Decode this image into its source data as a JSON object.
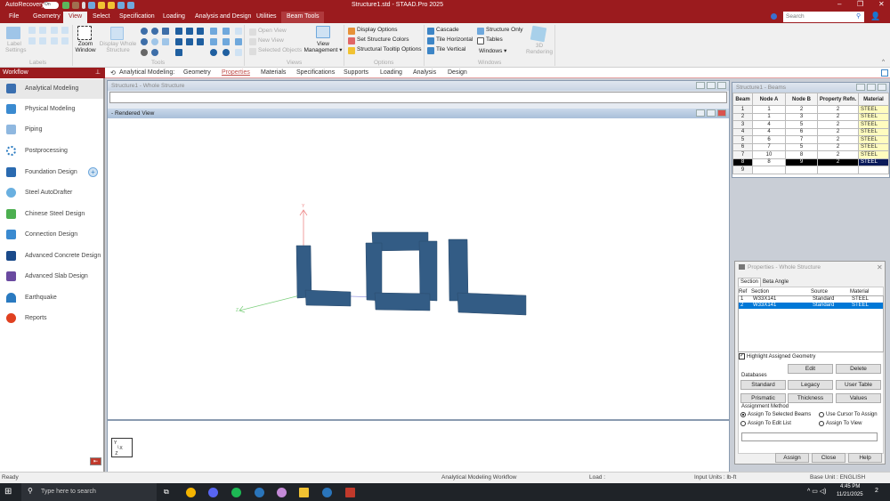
{
  "titlebar": {
    "autorecovery": "AutoRecovery",
    "toggle": "On",
    "title": "Structure1.std - STAAD.Pro 2025",
    "search_placeholder": "Search"
  },
  "tabs": [
    "File",
    "Geometry",
    "View",
    "Select",
    "Specification",
    "Loading",
    "Analysis and Design",
    "Utilities",
    "Beam Tools"
  ],
  "active_tab": "View",
  "ribbon": {
    "labels_group": {
      "label_settings": "Label Settings",
      "caption": "Labels"
    },
    "tools_group": {
      "zoom_window": "Zoom Window",
      "display_whole": "Display Whole Structure",
      "caption": "Tools"
    },
    "views_group": {
      "open_view": "Open View",
      "new_view": "New View",
      "selected_objects": "Selected Objects",
      "view_management": "View Management ▾",
      "caption": "Views"
    },
    "options_group": {
      "display_options": "Display Options",
      "set_colors": "Set Structure Colors",
      "tooltip_options": "Structural Tooltip Options",
      "caption": "Options"
    },
    "windows_group": {
      "cascade": "Cascade",
      "tile_horizontal": "Tile Horizontal",
      "tile_vertical": "Tile Vertical",
      "structure_only": "Structure Only",
      "tables": "Tables",
      "windows": "Windows ▾",
      "caption": "Windows"
    },
    "rendering": "3D Rendering"
  },
  "workflow": {
    "title": "Workflow",
    "items": [
      {
        "label": "Analytical Modeling",
        "color": "#3a6fb0"
      },
      {
        "label": "Physical Modeling",
        "color": "#3a8ad0"
      },
      {
        "label": "Piping",
        "color": "#8fb8e0"
      },
      {
        "label": "Postprocessing",
        "color": "#2a7ac0"
      },
      {
        "label": "Foundation Design",
        "color": "#2a6ab0"
      },
      {
        "label": "Steel AutoDrafter",
        "color": "#6ab0e0"
      },
      {
        "label": "Chinese Steel Design",
        "color": "#4caf50"
      },
      {
        "label": "Connection Design",
        "color": "#3a8ad0"
      },
      {
        "label": "Advanced Concrete Design",
        "color": "#1a4a8a"
      },
      {
        "label": "Advanced Slab Design",
        "color": "#6a4aa0"
      },
      {
        "label": "Earthquake",
        "color": "#2a7ac0"
      },
      {
        "label": "Reports",
        "color": "#e04020"
      }
    ]
  },
  "app_tabs": {
    "prefix": "Analytical Modeling:",
    "items": [
      "Geometry",
      "Properties",
      "Materials",
      "Specifications",
      "Supports",
      "Loading",
      "Analysis",
      "Design"
    ],
    "active": "Properties"
  },
  "structure_window": {
    "title": "Structure1 - Whole Structure"
  },
  "rendered_view": {
    "title": "- Rendered View",
    "axis_y": "Y",
    "axis_z": "Z"
  },
  "beams_table": {
    "title": "Structure1 - Beams",
    "columns": [
      "Beam",
      "Node A",
      "Node B",
      "Property Refn.",
      "Material"
    ],
    "rows": [
      [
        "1",
        "1",
        "2",
        "2",
        "STEEL"
      ],
      [
        "2",
        "1",
        "3",
        "2",
        "STEEL"
      ],
      [
        "3",
        "4",
        "5",
        "2",
        "STEEL"
      ],
      [
        "4",
        "4",
        "6",
        "2",
        "STEEL"
      ],
      [
        "5",
        "6",
        "7",
        "2",
        "STEEL"
      ],
      [
        "6",
        "7",
        "5",
        "2",
        "STEEL"
      ],
      [
        "7",
        "10",
        "8",
        "2",
        "STEEL"
      ],
      [
        "8",
        "8",
        "9",
        "2",
        "STEEL"
      ],
      [
        "9",
        "",
        "",
        "",
        ""
      ]
    ],
    "selected_row": 8
  },
  "properties": {
    "title": "Properties - Whole Structure",
    "tabs": [
      "Section",
      "Beta Angle"
    ],
    "columns": [
      "Ref",
      "Section",
      "Source",
      "Material"
    ],
    "rows": [
      [
        "1",
        "W33X141",
        "Standard",
        "STEEL"
      ],
      [
        "2",
        "W33X141",
        "Standard",
        "STEEL"
      ]
    ],
    "selected_row": 2,
    "highlight": "Highlight Assigned Geometry",
    "highlight_checked": true,
    "edit": "Edit",
    "delete": "Delete",
    "databases": "Databases",
    "standard": "Standard",
    "legacy": "Legacy",
    "user_table": "User Table",
    "prismatic": "Prismatic",
    "thickness": "Thickness",
    "values": "Values",
    "assignment_method": "Assignment Method",
    "assign_selected": "Assign To Selected Beams",
    "use_cursor": "Use Cursor To Assign",
    "assign_edit_list": "Assign To Edit List",
    "assign_view": "Assign To View",
    "selected_method": "Assign To Selected Beams",
    "assign": "Assign",
    "close": "Close",
    "help": "Help"
  },
  "statusbar": {
    "ready": "Ready",
    "workflow": "Analytical Modeling Workflow",
    "load": "Load :",
    "input_units": "Input Units : lb-ft",
    "base_unit": "Base Unit : ENGLISH"
  },
  "taskbar": {
    "search": "Type here to search",
    "time": "4:45 PM",
    "date": "11/21/2025",
    "notifications": "2"
  },
  "colors": {
    "brand": "#9b1b1e",
    "member": "#335c85",
    "selection": "#0078d7"
  }
}
